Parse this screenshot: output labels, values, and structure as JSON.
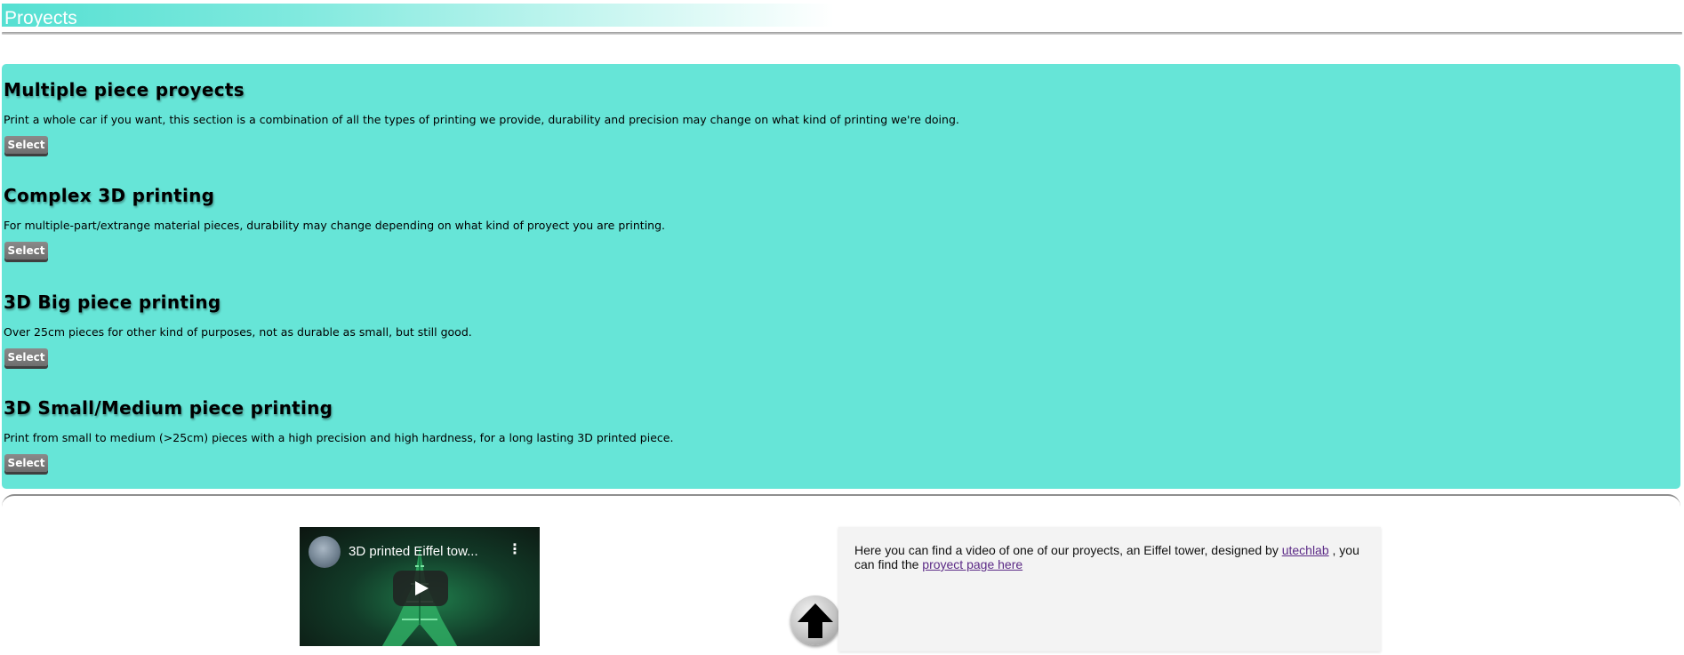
{
  "header": {
    "title": "Proyects"
  },
  "services": [
    {
      "title": "Multiple piece proyects",
      "description": "Print a whole car if you want, this section is a combination of all the types of printing we provide, durability and precision may change on what kind of printing we're doing.",
      "button_label": "Select"
    },
    {
      "title": "Complex 3D printing",
      "description": "For multiple-part/extrange material pieces, durability may change depending on what kind of proyect you are printing.",
      "button_label": "Select"
    },
    {
      "title": "3D Big piece printing",
      "description": "Over 25cm pieces for other kind of purposes, not as durable as small, but still good.",
      "button_label": "Select"
    },
    {
      "title": "3D Small/Medium piece printing",
      "description": "Print from small to medium (>25cm) pieces with a high precision and high hardness, for a long lasting 3D printed piece.",
      "button_label": "Select"
    }
  ],
  "video": {
    "title": "3D printed Eiffel tow...",
    "menu_icon": "more-vert-icon",
    "play_icon": "play-icon"
  },
  "scroll_top": {
    "icon": "arrow-up-icon"
  },
  "info": {
    "text_before": "Here you can find a video of one of our proyects, an Eiffel tower, designed by ",
    "author_link": "utechlab",
    "text_middle": " , you can find the ",
    "page_link": "proyect page here"
  },
  "colors": {
    "section_bg": "#66e5d7",
    "header_gradient_start": "#55e0d2",
    "button_bg": "#7a7a7a",
    "link": "#5b2a86",
    "info_bg": "#f3f3f3"
  }
}
